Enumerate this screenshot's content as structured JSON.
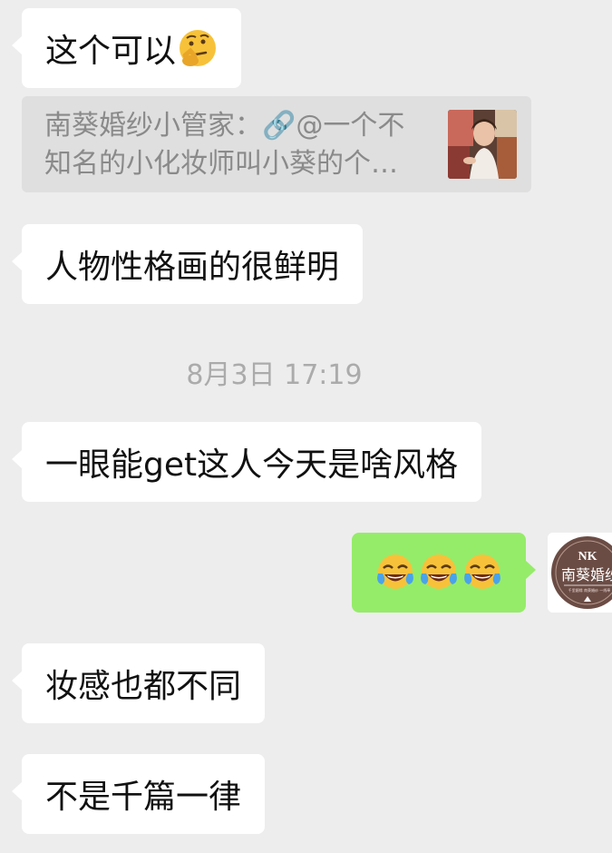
{
  "chat": {
    "messages": [
      {
        "text": "这个可以",
        "emoji": "thinking-face"
      },
      {
        "text": "人物性格画的很鲜明"
      },
      {
        "text": "一眼能get这人今天是啥风格"
      },
      {
        "text": "",
        "emoji": "tears-of-joy x3"
      },
      {
        "text": "妆感也都不同"
      },
      {
        "text": "不是千篇一律"
      }
    ],
    "quote": {
      "line1": "南葵婚纱小管家：🔗@一个不",
      "line2": "知名的小化妆师叫小葵的个…"
    },
    "timestamp": "8月3日 17:19",
    "avatar": {
      "logo": "NK",
      "name": "南葵婚纱",
      "tagline": "千里姻缘 南葵婚纱 一线牵",
      "color": "#6b4c44"
    }
  }
}
